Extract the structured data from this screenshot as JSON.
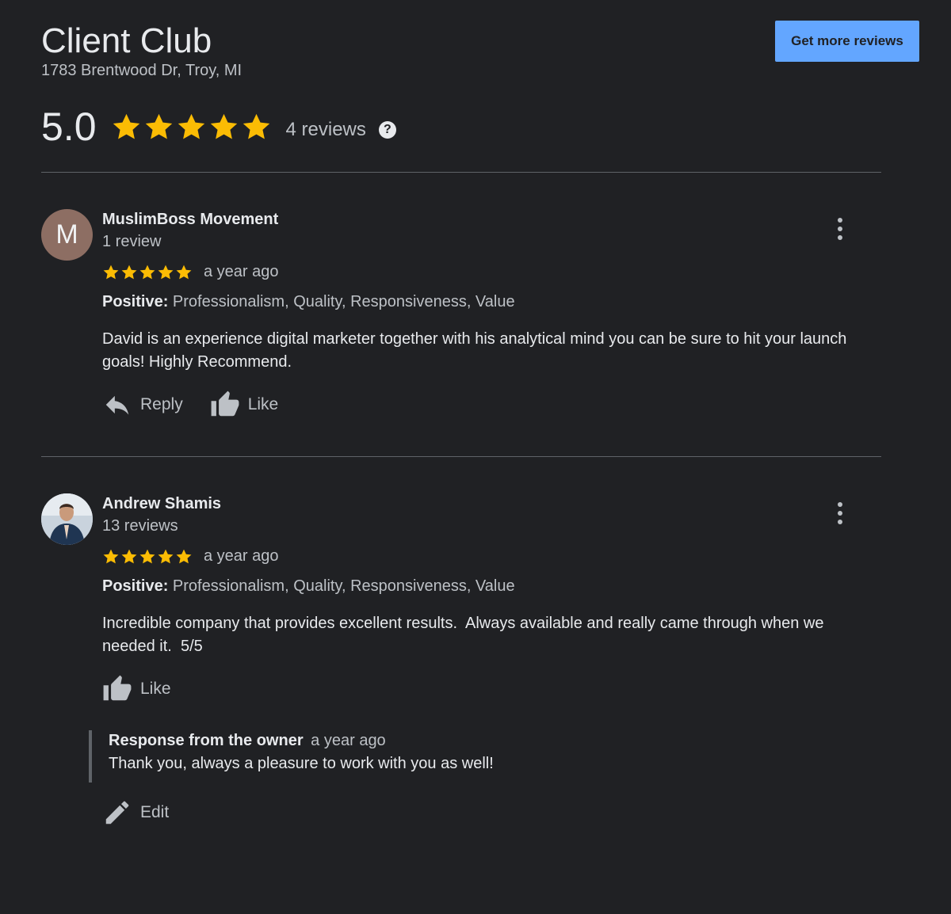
{
  "business": {
    "name": "Client Club",
    "address": "1783 Brentwood Dr, Troy, MI"
  },
  "cta_label": "Get more reviews",
  "summary": {
    "rating": "5.0",
    "stars": 5,
    "review_count": "4 reviews",
    "help_glyph": "?"
  },
  "colors": {
    "background": "#202124",
    "star": "#fbbc04",
    "button": "#63a6ff"
  },
  "reviews": [
    {
      "author": "MuslimBoss Movement",
      "author_reviews": "1 review",
      "avatar_letter": "M",
      "stars": 5,
      "time": "a year ago",
      "positive_label": "Positive:",
      "positive_values": "Professionalism, Quality, Responsiveness, Value",
      "text": "David is an experience digital marketer together with his analytical mind you can be sure to hit your launch goals! Highly Recommend.",
      "reply_label": "Reply",
      "like_label": "Like"
    },
    {
      "author": "Andrew Shamis",
      "author_reviews": "13 reviews",
      "avatar_icon": "user-photo-icon",
      "stars": 5,
      "time": "a year ago",
      "positive_label": "Positive:",
      "positive_values": "Professionalism, Quality, Responsiveness, Value",
      "text": "Incredible company that provides excellent results.  Always available and really came through when we needed it.  5/5",
      "like_label": "Like",
      "owner_response": {
        "label": "Response from the owner",
        "time": "a year ago",
        "text": "Thank you, always a pleasure to work with you as well!"
      },
      "edit_label": "Edit"
    }
  ]
}
